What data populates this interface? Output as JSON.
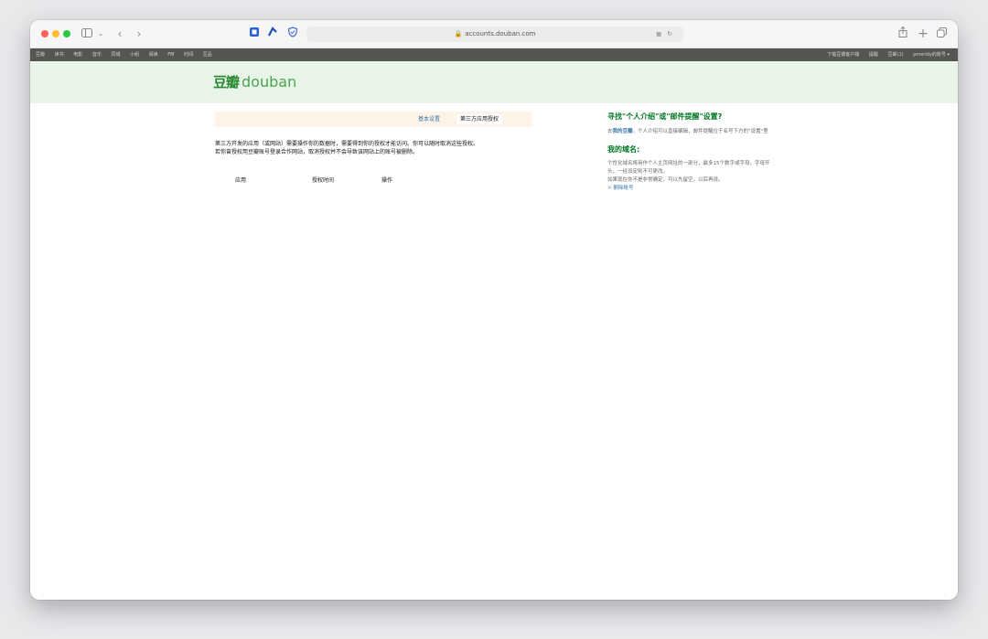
{
  "browser": {
    "url": "accounts.douban.com",
    "icons": [
      "sidebar-icon",
      "back-icon",
      "forward-icon",
      "extension-icon",
      "reader-icon",
      "shield-icon",
      "translate-icon",
      "reload-icon",
      "share-icon",
      "new-tab-icon",
      "tabs-icon"
    ]
  },
  "topnav": {
    "left": [
      "豆瓣",
      "读书",
      "电影",
      "音乐",
      "同城",
      "小组",
      "阅读",
      "FM",
      "时间",
      "豆品"
    ],
    "right": [
      "下载豆瓣客户端",
      "提醒",
      "豆邮(1)",
      "pmeridy的账号 ▾"
    ]
  },
  "header": {
    "logo_cn": "豆瓣",
    "logo_en": "douban"
  },
  "tabs": {
    "basic": "基本设置",
    "third_party": "第三方应用授权"
  },
  "main": {
    "intro_line1": "第三方开发的应用（或网站）需要操作你的数据时，需要得到你的授权才能访问。你可以随时取消这些授权。",
    "intro_line2": "若你曾授权用豆瓣账号登录合作网站，取消授权并不会导致该网站上的账号被删除。",
    "columns": [
      "应用",
      "授权时间",
      "操作"
    ]
  },
  "aside": {
    "find_title": "寻找\"个人介绍\"或\"邮件提醒\"设置?",
    "find_pre": "去",
    "find_link": "我的豆瓣",
    "find_post": "。个人介绍可以直接编辑，邮件提醒位于名号下方的\"设置\"里",
    "domain_title": "我的域名:",
    "domain_text1": "个性化域名将用作个人主页网址的一部分，最多15个数字或字母，字母开头，一经设定则不可更改。",
    "domain_text2": "如果现在你不是非常确定，可以先留空，以后再说。",
    "delete_prefix": "> ",
    "delete_link": "删除账号"
  },
  "colors": {
    "nav_bg": "#545652",
    "header_bg": "#e9f4e9",
    "brand_green": "#2a8a32",
    "link_blue": "#3377aa",
    "tab_bg": "#fff3e8"
  }
}
